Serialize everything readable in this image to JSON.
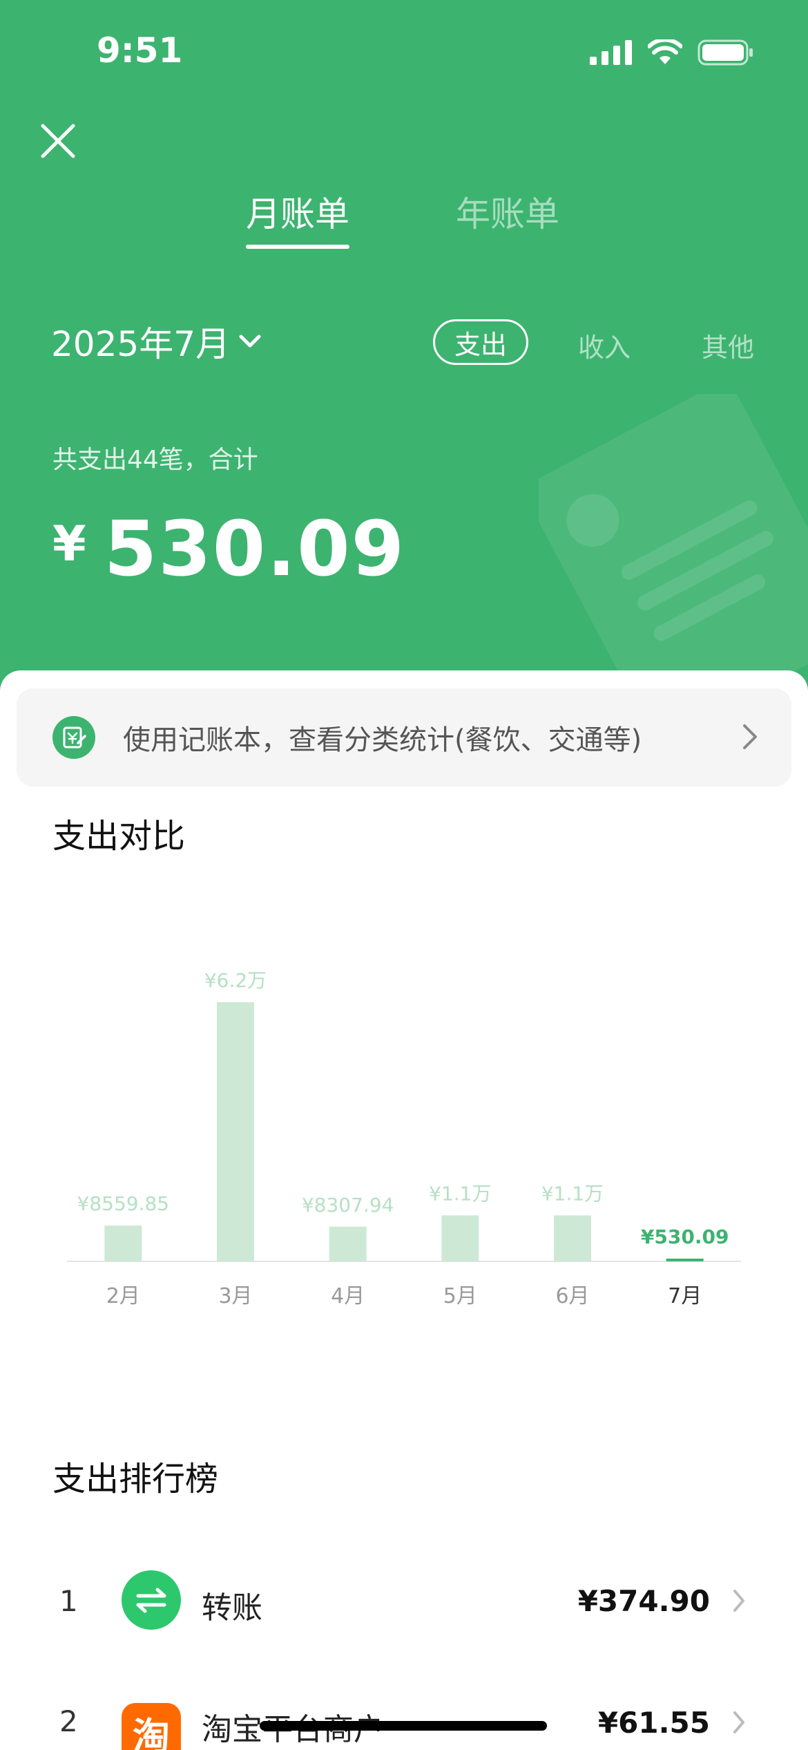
{
  "status": {
    "time": "9:51"
  },
  "header": {
    "tabs": [
      {
        "label": "月账单"
      },
      {
        "label": "年账单"
      }
    ],
    "date": "2025年7月",
    "type_tabs": [
      {
        "label": "支出"
      },
      {
        "label": "收入"
      },
      {
        "label": "其他"
      }
    ],
    "summary": "共支出44笔，合计",
    "currency": "¥",
    "total": "530.09"
  },
  "banner": {
    "text": "使用记账本，查看分类统计(餐饮、交通等)"
  },
  "comparison": {
    "title": "支出对比"
  },
  "chart_data": {
    "type": "bar",
    "categories": [
      "2月",
      "3月",
      "4月",
      "5月",
      "6月",
      "7月"
    ],
    "values": [
      8559.85,
      62000,
      8307.94,
      11000,
      11000,
      530.09
    ],
    "data_labels": [
      "¥8559.85",
      "¥6.2万",
      "¥8307.94",
      "¥1.1万",
      "¥1.1万",
      "¥530.09"
    ],
    "highlight_index": 5,
    "ylim": [
      0,
      62000
    ],
    "colors": {
      "bar": "#cde9d6",
      "label": "#b6e0c4",
      "highlight": "#3db370"
    }
  },
  "ranking": {
    "title": "支出排行榜",
    "items": [
      {
        "rank": "1",
        "name": "转账",
        "amount": "¥374.90",
        "icon": "transfer-icon",
        "icon_color": "#2dc76d"
      },
      {
        "rank": "2",
        "name": "淘宝平台商户",
        "amount": "¥61.55",
        "icon": "taobao-icon",
        "icon_glyph": "淘",
        "icon_color": "#ff6a00"
      }
    ]
  },
  "colors": {
    "primary": "#3db370"
  }
}
